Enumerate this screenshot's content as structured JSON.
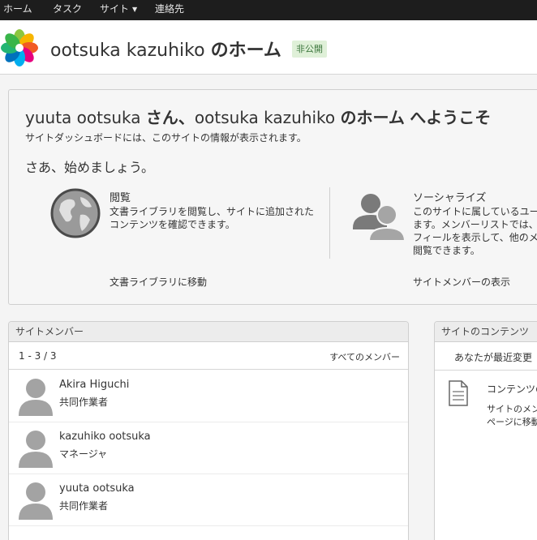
{
  "topnav": {
    "home": "ホーム",
    "tasks": "タスク",
    "sites": "サイト",
    "contacts": "連絡先"
  },
  "header": {
    "title_user": "ootsuka kazuhiko",
    "title_suffix": "のホーム",
    "badge": "非公開"
  },
  "welcome": {
    "title_user": "yuuta ootsuka",
    "title_san": "さん、",
    "title_owner": "ootsuka kazuhiko",
    "title_home": "のホーム",
    "title_end": "へようこそ",
    "description": "サイトダッシュボードには、このサイトの情報が表示されます。",
    "start": "さあ、始めましょう。",
    "browse": {
      "title": "閲覧",
      "line1": "文書ライブラリを閲覧し、サイトに追加された",
      "line2": "コンテンツを確認できます。",
      "link": "文書ライブラリに移動"
    },
    "socialize": {
      "title": "ソーシャライズ",
      "line1": "このサイトに属しているユーザ",
      "line2": "ます。メンバーリストでは、こ",
      "line3": "フィールを表示して、他のメン",
      "line4": "閲覧できます。",
      "link": "サイトメンバーの表示"
    }
  },
  "members": {
    "title": "サイトメンバー",
    "count": "1 - 3 / 3",
    "all_link": "すべてのメンバー",
    "list": [
      {
        "name": "Akira Higuchi",
        "role": "共同作業者"
      },
      {
        "name": "kazuhiko ootsuka",
        "role": "マネージャ"
      },
      {
        "name": "yuuta ootsuka",
        "role": "共同作業者"
      }
    ]
  },
  "content": {
    "title": "サイトのコンテンツ",
    "tab": "あなたが最近変更",
    "head": "コンテンツの",
    "line1": "サイトのメン",
    "line2": "ページに移動"
  },
  "colors": {
    "topbar": "#1d1d1d",
    "badge_bg": "#dff0d8",
    "badge_text": "#3c763d",
    "avatar": "#a3a3a3"
  },
  "icons": {
    "logo": "alfresco-flower-logo",
    "browse": "globe-icon",
    "socialize": "people-icon",
    "member_avatar": "user-avatar-icon",
    "content": "document-icon"
  }
}
